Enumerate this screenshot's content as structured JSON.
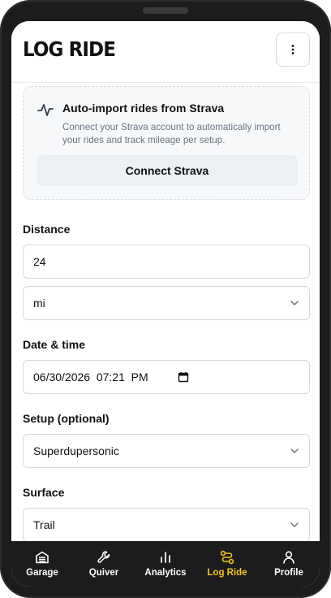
{
  "header": {
    "title": "LOG RIDE",
    "menu_icon": "vertical-dots-icon"
  },
  "strava": {
    "title": "Auto-import rides from Strava",
    "description": "Connect your Strava account to automatically import your rides and track mileage per setup.",
    "button_label": "Connect Strava",
    "icon": "activity-pulse-icon"
  },
  "form": {
    "distance": {
      "label": "Distance",
      "value": "24"
    },
    "unit": {
      "value": "mi"
    },
    "datetime": {
      "label": "Date & time",
      "value": "06/30/2026  07:21  PM"
    },
    "setup": {
      "label": "Setup (optional)",
      "value": "Superdupersonic"
    },
    "surface": {
      "label": "Surface",
      "value": "Trail"
    }
  },
  "tabs": [
    {
      "label": "Garage",
      "icon": "garage-icon",
      "active": false
    },
    {
      "label": "Quiver",
      "icon": "wrench-icon",
      "active": false
    },
    {
      "label": "Analytics",
      "icon": "bar-chart-icon",
      "active": false
    },
    {
      "label": "Log Ride",
      "icon": "route-icon",
      "active": true
    },
    {
      "label": "Profile",
      "icon": "user-icon",
      "active": false
    }
  ],
  "colors": {
    "accent": "#f5c518",
    "tabbar": "#1c1c1e",
    "card_bg": "#f7f8fa"
  }
}
